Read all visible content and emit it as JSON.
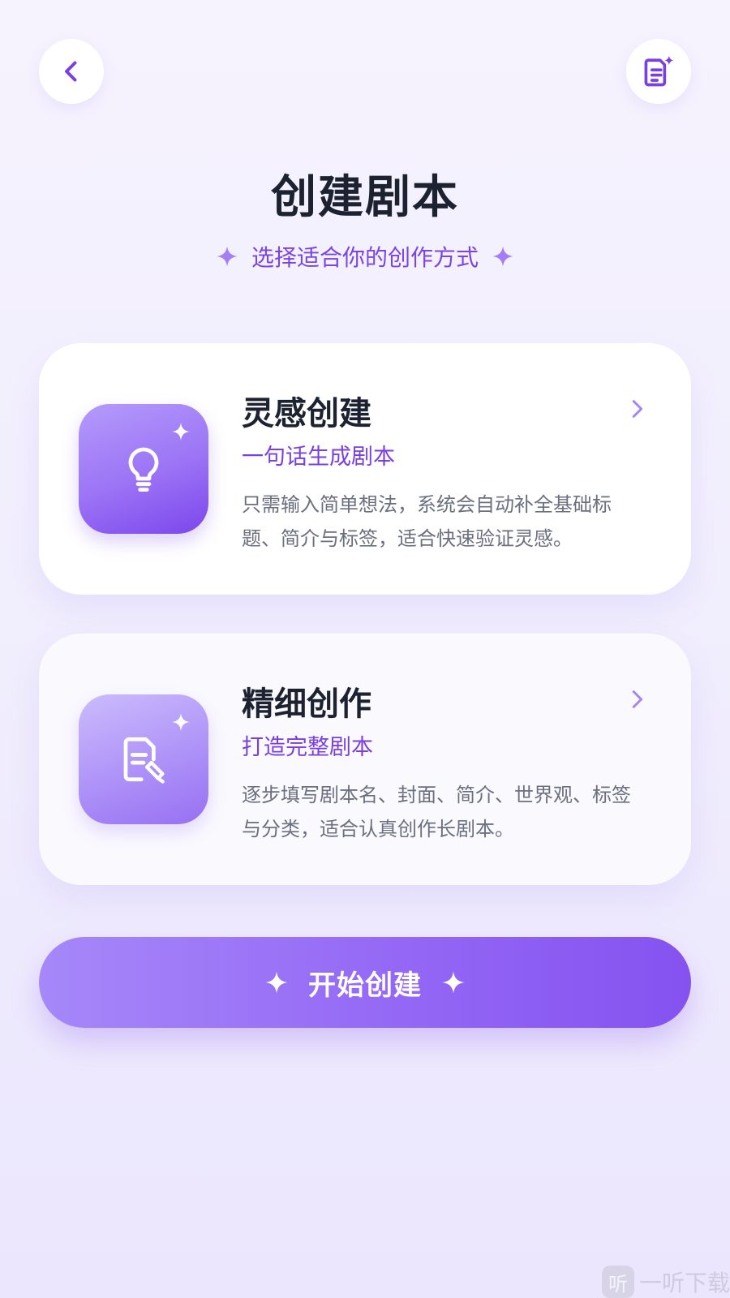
{
  "header": {
    "back_icon": "chevron-left-icon",
    "doc_icon": "document-sparkle-icon",
    "title": "创建剧本",
    "subtitle": "选择适合你的创作方式"
  },
  "cards": [
    {
      "title": "灵感创建",
      "tag": "一句话生成剧本",
      "description": "只需输入简单想法，系统会自动补全基础标题、简介与标签，适合快速验证灵感。",
      "icon": "lightbulb-icon"
    },
    {
      "title": "精细创作",
      "tag": "打造完整剧本",
      "description": "逐步填写剧本名、封面、简介、世界观、标签与分类，适合认真创作长剧本。",
      "icon": "document-edit-icon"
    }
  ],
  "start_button": {
    "label": "开始创建"
  },
  "watermark": {
    "logo_text": "听",
    "text": "一听下载"
  },
  "colors": {
    "accent": "#7c46ec",
    "accent_light": "#a688f9",
    "title_text": "#1c2230",
    "body_text": "#6b7080",
    "background": "#f3f0fe"
  }
}
